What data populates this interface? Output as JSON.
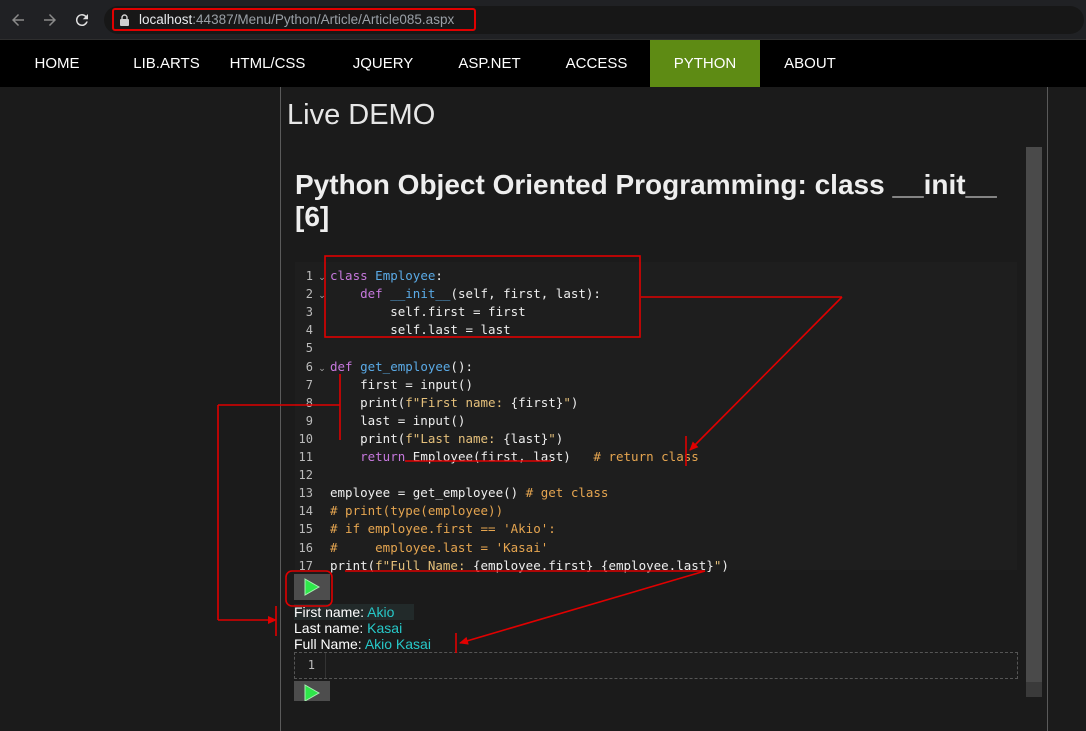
{
  "browser": {
    "url_host": "localhost",
    "url_rest": ":44387/Menu/Python/Article/Article085.aspx"
  },
  "nav": {
    "items": [
      {
        "label": "HOME",
        "active": false
      },
      {
        "label": "LIB.ARTS",
        "active": false
      },
      {
        "label": "HTML/CSS",
        "active": false
      },
      {
        "label": "JQUERY",
        "active": false
      },
      {
        "label": "ASP.NET",
        "active": false
      },
      {
        "label": "ACCESS",
        "active": false
      },
      {
        "label": "PYTHON",
        "active": true
      },
      {
        "label": "ABOUT",
        "active": false
      }
    ]
  },
  "page": {
    "live_title": "Live DEMO",
    "heading": "Python Object Oriented Programming: class __init__ [6]"
  },
  "code": {
    "line_numbers": [
      "1",
      "2",
      "3",
      "4",
      "5",
      "6",
      "7",
      "8",
      "9",
      "10",
      "11",
      "12",
      "13",
      "14",
      "15",
      "16",
      "17"
    ],
    "fold_markers": {
      "1": "⌄",
      "2": "⌄",
      "6": "⌄"
    },
    "lines": [
      "<span class=\"kw\">class</span> <span class=\"cls\">Employee</span>:",
      "    <span class=\"kw\">def</span> <span class=\"fn\">__init__</span>(self, first, last):",
      "        self.first = first",
      "        self.last = last",
      "",
      "<span class=\"kw\">def</span> <span class=\"fn\">get_employee</span>():",
      "    first = input()",
      "    print(<span class=\"str\">f\"First name: </span>{first}<span class=\"str\">\"</span>)",
      "    last = input()",
      "    print(<span class=\"str\">f\"Last name: </span>{last}<span class=\"str\">\"</span>)",
      "    <span class=\"kw\">return</span> Employee(first, last)   <span class=\"cm\"># return class</span>",
      "",
      "employee = get_employee() <span class=\"cm\"># get class</span>",
      "<span class=\"cm\"># print(type(employee))</span>",
      "<span class=\"cm\"># if employee.first == 'Akio':</span>",
      "<span class=\"cm\">#     employee.last = 'Kasai'</span>",
      "print(<span class=\"str\">f\"Full Name: </span>{employee.first} {employee.last}<span class=\"str\">\"</span>)"
    ]
  },
  "output": {
    "rows": [
      {
        "label": "First name: ",
        "value": "Akio"
      },
      {
        "label": "Last name: ",
        "value": "Kasai"
      },
      {
        "label": "Full Name: ",
        "value": "Akio Kasai"
      }
    ]
  },
  "editor2": {
    "line_number": "1"
  },
  "icons": {
    "back": "arrow-left-icon",
    "forward": "arrow-right-icon",
    "reload": "reload-icon",
    "lock": "lock-icon",
    "run": "play-icon"
  },
  "colors": {
    "nav_active": "#5e8b14",
    "annotation": "#e00000",
    "output_value": "#27c8c8",
    "play": "#2ee84a"
  }
}
